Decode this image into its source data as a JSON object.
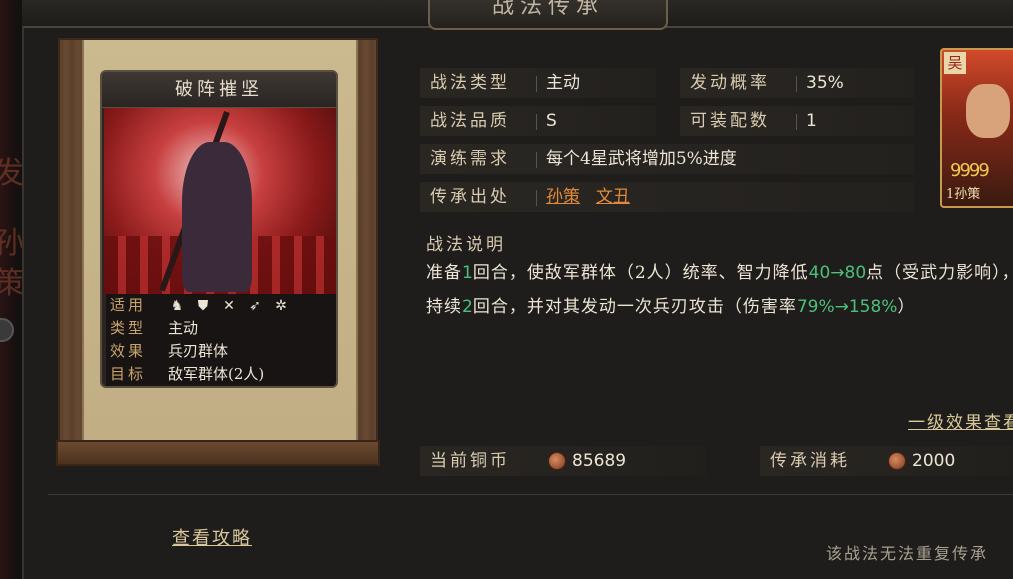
{
  "window": {
    "title": "战法传承"
  },
  "left_edge": {
    "glyphs": [
      "发",
      "孙",
      "策"
    ]
  },
  "skill_card": {
    "name": "破阵摧坚",
    "rows": [
      {
        "label": "适用",
        "icons": [
          "cavalry-icon",
          "shield-icon",
          "bow-icon",
          "spear-icon",
          "siege-wheel-icon"
        ]
      },
      {
        "label": "类型",
        "value": "主动"
      },
      {
        "label": "效果",
        "value": "兵刃群体"
      },
      {
        "label": "目标",
        "value": "敌军群体(2人)"
      }
    ]
  },
  "attributes": {
    "type_label": "战法类型",
    "type_value": "主动",
    "rate_label": "发动概率",
    "rate_value": "35%",
    "quality_label": "战法品质",
    "quality_value": "S",
    "slots_label": "可装配数",
    "slots_value": "1",
    "practice_label": "演练需求",
    "practice_value": "每个4星武将增加5%进度",
    "source_label": "传承出处",
    "source_values": [
      "孙策",
      "文丑"
    ]
  },
  "portrait": {
    "faction": "吴",
    "stars": "9999",
    "name": "1孙策"
  },
  "description": {
    "title": "战法说明",
    "p1": "准备",
    "n1": "1",
    "p2": "回合，使敌军群体（2人）统率、智力降低",
    "n2": "40→80",
    "p3": "点（受武力影响），持续",
    "n3": "2",
    "p4": "回合，并对其发动一次兵刃攻击（伤害率",
    "n4": "79%→158%",
    "p5": "）"
  },
  "effect_link": "一级效果查看",
  "currency": {
    "coins_label": "当前铜币",
    "coins_value": "85689",
    "cost_label": "传承消耗",
    "cost_value": "2000"
  },
  "guide_link": "查看攻略",
  "footer_note": "该战法无法重复传承"
}
